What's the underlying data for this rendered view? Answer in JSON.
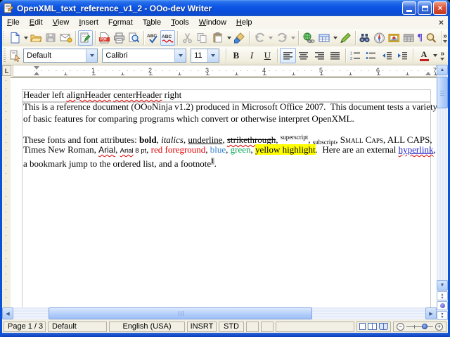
{
  "window": {
    "title": "OpenXML_text_reference_v1_2 - OOo-dev Writer",
    "close_glyph": "×"
  },
  "menu": {
    "items": [
      {
        "label": "File",
        "accel": 0
      },
      {
        "label": "Edit",
        "accel": 0
      },
      {
        "label": "View",
        "accel": 0
      },
      {
        "label": "Insert",
        "accel": 0
      },
      {
        "label": "Format",
        "accel": 1
      },
      {
        "label": "Table",
        "accel": 1
      },
      {
        "label": "Tools",
        "accel": 0
      },
      {
        "label": "Window",
        "accel": 0
      },
      {
        "label": "Help",
        "accel": 0
      }
    ],
    "close_glyph": "×"
  },
  "toolbar_main": {
    "abc_label": "ABC",
    "pdf_label": "PDF",
    "pilcrow_label": "¶",
    "overflow_glyph": "»"
  },
  "toolbar_format": {
    "paragraph_style": "Default",
    "font_name": "Calibri",
    "font_size": "11",
    "bold_label": "B",
    "italic_label": "I",
    "underline_label": "U",
    "font_color_label": "A",
    "overflow_glyph": "»"
  },
  "ruler": {
    "tab_selector": "L",
    "numbers": [
      "1",
      "2",
      "3",
      "4",
      "5",
      "6",
      "7"
    ]
  },
  "icons": {
    "up": "▲",
    "down": "▼",
    "left": "◀",
    "right": "▶",
    "minus": "−",
    "plus": "+"
  },
  "document": {
    "lines": [
      {
        "kind": "h",
        "segs": [
          {
            "t": "Header left "
          },
          {
            "t": "alignHeader",
            "c": "sq"
          },
          {
            "t": " "
          },
          {
            "t": "centerHeader",
            "c": "sq"
          },
          {
            "t": " right"
          }
        ]
      },
      {
        "kind": "n",
        "segs": [
          {
            "t": "This is a reference document (OOoNinja v1.2) produced in Microsoft Office 2007.  This document tests a variety"
          }
        ]
      },
      {
        "kind": "n",
        "segs": [
          {
            "t": "of basic features for comparing programs which convert or otherwise interpret OpenXML."
          }
        ]
      },
      {
        "kind": "bl",
        "segs": []
      },
      {
        "kind": "n",
        "segs": [
          {
            "t": "These fonts and font attributes: "
          },
          {
            "t": "bold",
            "c": "b"
          },
          {
            "t": ", "
          },
          {
            "t": "italics",
            "c": "i"
          },
          {
            "t": ", "
          },
          {
            "t": "underline",
            "c": "u"
          },
          {
            "t": ", "
          },
          {
            "t": "strikethrough",
            "c": "st sq"
          },
          {
            "t": ", "
          },
          {
            "t": "superscript",
            "c": "sup"
          },
          {
            "t": ", "
          },
          {
            "t": "subscript",
            "c": "sub"
          },
          {
            "t": ", "
          },
          {
            "t": "Small Caps",
            "c": "sc"
          },
          {
            "t": ", ALL CAPS,"
          }
        ]
      },
      {
        "kind": "n",
        "segs": [
          {
            "t": "Times New Roman, "
          },
          {
            "t": "Arial",
            "c": "ar sq"
          },
          {
            "t": ", "
          },
          {
            "t": "Arial",
            "c": "ar8 sq"
          },
          {
            "t": " 8 pt",
            "c": "ar8"
          },
          {
            "t": ", "
          },
          {
            "t": "red foreground",
            "c": "red"
          },
          {
            "t": ", "
          },
          {
            "t": "blue",
            "c": "blue"
          },
          {
            "t": ", "
          },
          {
            "t": "green",
            "c": "green"
          },
          {
            "t": ", "
          },
          {
            "t": "yellow highlight",
            "c": "hl"
          },
          {
            "t": ".  Here are an external "
          },
          {
            "t": "hyperlink",
            "c": "lnk sq"
          },
          {
            "t": ","
          }
        ]
      },
      {
        "kind": "n",
        "segs": [
          {
            "t": "a bookmark jump to the ordered list, and a footnote"
          },
          {
            "t": "1",
            "c": "fn"
          },
          {
            "t": "."
          }
        ]
      }
    ]
  },
  "statusbar": {
    "page": "Page 1 / 3",
    "page_style": "Default",
    "language": "English (USA)",
    "insert_mode": "INSRT",
    "selection_mode": "STD"
  },
  "colors": {
    "title_blue": "#0e57e4",
    "toolbar_face": "#f2efe4",
    "squiggle_red": "#e00000",
    "text_red": "#e00000",
    "text_blue": "#2f7ed0",
    "text_green": "#00a650",
    "highlight_yellow": "#ffff00",
    "hyperlink_blue": "#2222cc"
  }
}
